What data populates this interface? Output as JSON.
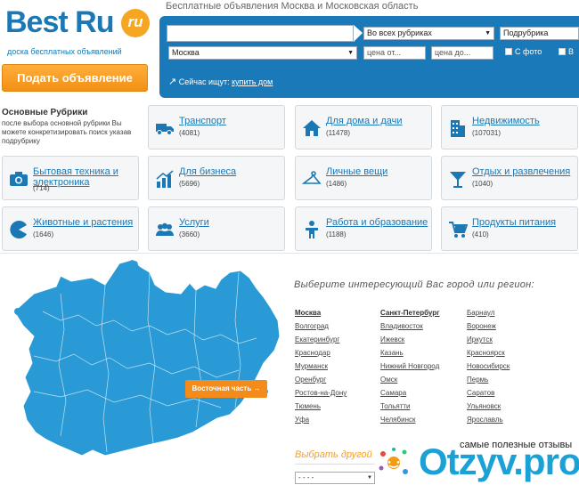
{
  "logo": {
    "main": "Best Ru",
    "badge": "ru",
    "subtitle": "доска бесплатных объявлений"
  },
  "post_button": "Подать объявление",
  "header_title": "Бесплатные объявления Москва и Московская область",
  "search": {
    "query_value": "",
    "rubric_select": "Во всех рубриках",
    "subrubric_select": "Подрубрика",
    "region_select": "Москва",
    "price_from_placeholder": "цена от...",
    "price_to_placeholder": "цена до...",
    "with_photo_label": "С фото",
    "second_checkbox_label": "В",
    "hint_prefix": "Сейчас ищут:",
    "hint_link": "купить дом"
  },
  "rubrics": {
    "title": "Основные Рубрики",
    "description": "после выбора основной рубрики Вы можете конкретизировать поиск указав подрубрику",
    "items": [
      {
        "name": "Транспорт",
        "count": "(4081)",
        "icon": "truck-icon"
      },
      {
        "name": "Для дома и дачи",
        "count": "(11478)",
        "icon": "house-icon"
      },
      {
        "name": "Недвижимость",
        "count": "(107031)",
        "icon": "building-icon"
      },
      {
        "name": "Бытовая техника и электроника",
        "count": "(714)",
        "icon": "camera-icon"
      },
      {
        "name": "Для бизнеса",
        "count": "(5696)",
        "icon": "chart-icon"
      },
      {
        "name": "Личные вещи",
        "count": "(1486)",
        "icon": "hanger-icon"
      },
      {
        "name": "Отдых и развлечения",
        "count": "(1040)",
        "icon": "cocktail-icon"
      },
      {
        "name": "Животные и растения",
        "count": "(1646)",
        "icon": "pacman-icon"
      },
      {
        "name": "Услуги",
        "count": "(3660)",
        "icon": "people-icon"
      },
      {
        "name": "Работа и образование",
        "count": "(1188)",
        "icon": "person-icon"
      },
      {
        "name": "Продукты питания",
        "count": "(410)",
        "icon": "cart-icon"
      }
    ]
  },
  "map": {
    "region_button": "Восточная часть →"
  },
  "cities": {
    "title": "Выберите интересующий Вас город или регион:",
    "col1": [
      "Москва",
      "Волгоград",
      "Екатеринбург",
      "Краснодар",
      "Мурманск",
      "Оренбург",
      "Ростов-на-Дону",
      "Тюмень",
      "Уфа"
    ],
    "col2": [
      "Санкт-Петербург",
      "Владивосток",
      "Ижевск",
      "Казань",
      "Нижний Новгород",
      "Омск",
      "Самара",
      "Тольятти",
      "Челябинск"
    ],
    "col3": [
      "Барнаул",
      "Воронеж",
      "Иркутск",
      "Красноярск",
      "Новосибирск",
      "Пермь",
      "Саратов",
      "Ульяновск",
      "Ярославль"
    ],
    "other_label": "Выбрать другой",
    "other_select": "- - - -"
  },
  "watermark": {
    "tagline": "самые полезные отзывы",
    "word": "Otzyv.pro"
  },
  "colors": {
    "brand_blue": "#1a79b9",
    "accent_orange": "#f39014",
    "map_blue": "#2a9ad6"
  }
}
